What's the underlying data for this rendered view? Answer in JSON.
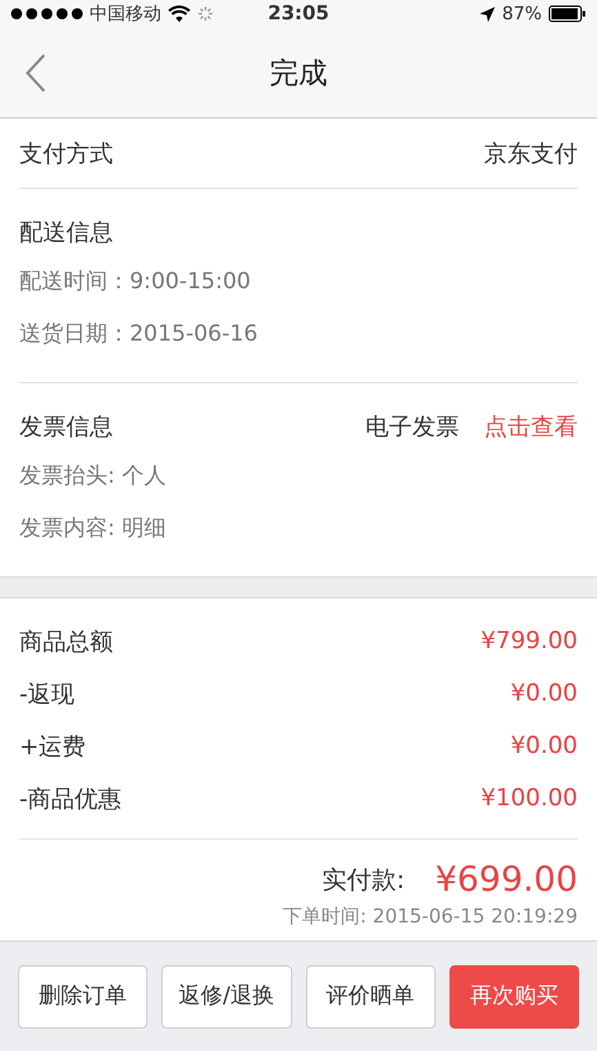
{
  "status_bar": {
    "carrier": "中国移动",
    "time": "23:05",
    "battery": "87%"
  },
  "nav": {
    "title": "完成"
  },
  "payment": {
    "label": "支付方式",
    "value": "京东支付"
  },
  "delivery": {
    "title": "配送信息",
    "lines": [
      "配送时间：9:00-15:00",
      "送货日期：2015-06-16"
    ]
  },
  "invoice": {
    "title": "发票信息",
    "type": "电子发票",
    "link": "点击查看",
    "lines": [
      "发票抬头: 个人",
      "发票内容: 明细"
    ]
  },
  "amounts": [
    {
      "label": "商品总额",
      "value": "¥799.00"
    },
    {
      "label": "-返现",
      "value": "¥0.00"
    },
    {
      "label": "+运费",
      "value": "¥0.00"
    },
    {
      "label": "-商品优惠",
      "value": "¥100.00"
    }
  ],
  "total": {
    "label": "实付款:",
    "value": "¥699.00",
    "order_time": "下单时间: 2015-06-15 20:19:29"
  },
  "buttons": [
    {
      "label": "删除订单",
      "kind": "outline"
    },
    {
      "label": "返修/退换",
      "kind": "outline"
    },
    {
      "label": "评价晒单",
      "kind": "outline"
    },
    {
      "label": "再次购买",
      "kind": "primary"
    }
  ]
}
